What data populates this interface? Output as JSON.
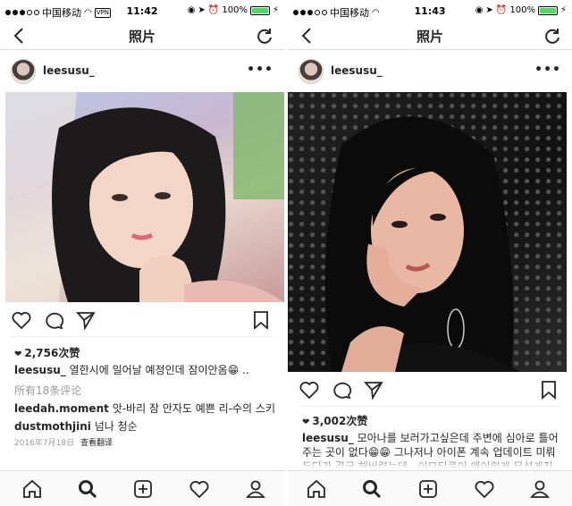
{
  "left": {
    "status": {
      "carrier": "中国移动",
      "vpn": "VPN",
      "time": "11:42",
      "battery": "100%",
      "battery_level": 1.0
    },
    "nav": {
      "title": "照片"
    },
    "post": {
      "username": "leesusu_",
      "likes": "2,756次赞",
      "caption_user": "leesusu_",
      "caption_text": "열한시에 일어날 예정인데 잠이안옴😁 ..",
      "view_comments": "所有18条评论",
      "comments": [
        {
          "user": "leedah.moment",
          "text": "앗-바리 잠 안자도 예쁜 리-수의 스키-인!"
        },
        {
          "user": "dustmothjini",
          "text": "넘나 청순"
        }
      ],
      "date": "2016年7月18日",
      "translate": "查看翻译"
    }
  },
  "right": {
    "status": {
      "carrier": "中国移动",
      "vpn": "",
      "time": "11:43",
      "battery": "100%",
      "battery_level": 1.0
    },
    "nav": {
      "title": "照片"
    },
    "post": {
      "username": "leesusu_",
      "likes": "3,002次赞",
      "caption_user": "leesusu_",
      "caption_text": "모아나를 보러가고싶은데 주변에 심아로 틀어주는 곳이 없다😁😁 그나저나 아이폰 계속 업데이트 미뤄두다가 결국 해버렸는데.. 이모티콘이 왜이렇게 무섭게진거죠...??😁"
    }
  },
  "icons": {
    "back": "chevron-left-icon",
    "refresh": "refresh-icon",
    "more": "more-icon",
    "like": "heart-outline-icon",
    "comment": "comment-icon",
    "share": "paper-plane-icon",
    "save": "bookmark-icon",
    "home": "home-icon",
    "search": "search-icon",
    "add": "add-post-icon",
    "activity": "heart-icon",
    "profile": "profile-icon"
  }
}
